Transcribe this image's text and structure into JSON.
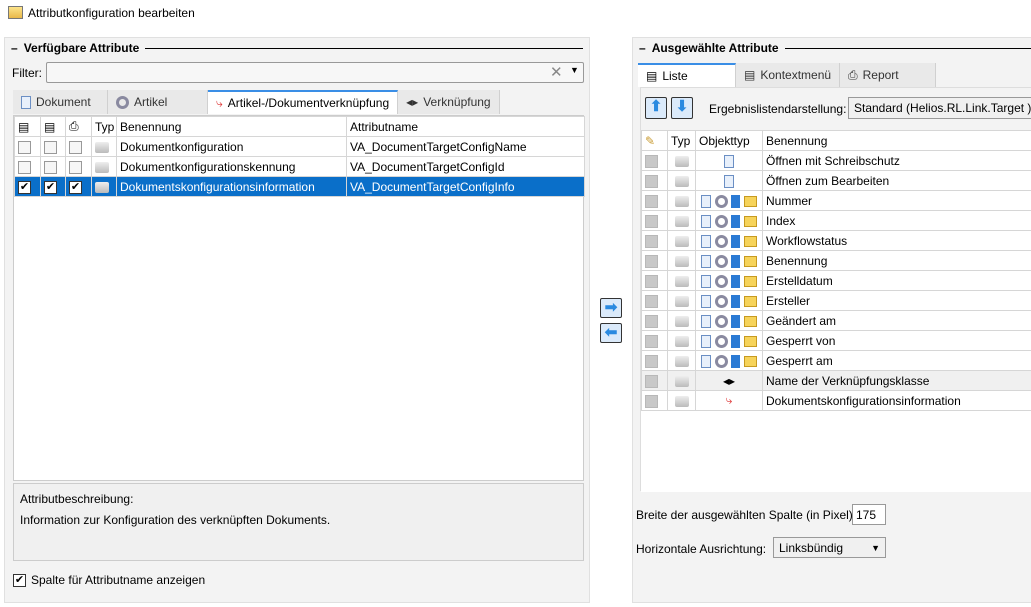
{
  "window": {
    "title": "Attributkonfiguration bearbeiten"
  },
  "left": {
    "group_title": "Verfügbare Attribute",
    "filter_label": "Filter:",
    "filter_value": "",
    "tabs": [
      {
        "label": "Dokument"
      },
      {
        "label": "Artikel"
      },
      {
        "label": "Artikel-/Dokumentverknüpfung",
        "active": true
      },
      {
        "label": "Verknüpfung"
      }
    ],
    "columns": {
      "typ": "Typ",
      "benennung": "Benennung",
      "attributname": "Attributname"
    },
    "rows": [
      {
        "benennung": "Dokumentkonfiguration",
        "attributname": "VA_DocumentTargetConfigName",
        "checks": [
          false,
          false,
          false
        ]
      },
      {
        "benennung": "Dokumentkonfigurationskennung",
        "attributname": "VA_DocumentTargetConfigId",
        "checks": [
          false,
          false,
          false
        ]
      },
      {
        "benennung": "Dokumentskonfigurationsinformation",
        "attributname": "VA_DocumentTargetConfigInfo",
        "checks": [
          true,
          true,
          true
        ],
        "selected": true
      }
    ],
    "description_label": "Attributbeschreibung:",
    "description_text": "Information zur Konfiguration des verknüpften Dokuments.",
    "show_attrname_label": "Spalte für Attributname anzeigen",
    "show_attrname_checked": true
  },
  "right": {
    "group_title": "Ausgewählte Attribute",
    "tabs": [
      {
        "label": "Liste",
        "active": true
      },
      {
        "label": "Kontextmenü"
      },
      {
        "label": "Report"
      }
    ],
    "ergebnis_label": "Ergebnislistendarstellung:",
    "ergebnis_value": "Standard (Helios.RL.Link.Target )",
    "columns": {
      "typ": "Typ",
      "objekttyp": "Objekttyp",
      "benennung": "Benennung"
    },
    "rows": [
      {
        "benennung": "Öffnen mit Schreibschutz",
        "icons": "doc"
      },
      {
        "benennung": "Öffnen zum Bearbeiten",
        "icons": "doc"
      },
      {
        "benennung": "Nummer",
        "icons": "all"
      },
      {
        "benennung": "Index",
        "icons": "all"
      },
      {
        "benennung": "Workflowstatus",
        "icons": "all"
      },
      {
        "benennung": "Benennung",
        "icons": "all"
      },
      {
        "benennung": "Erstelldatum",
        "icons": "all"
      },
      {
        "benennung": "Ersteller",
        "icons": "all"
      },
      {
        "benennung": "Geändert am",
        "icons": "all"
      },
      {
        "benennung": "Gesperrt von",
        "icons": "all"
      },
      {
        "benennung": "Gesperrt am",
        "icons": "all"
      },
      {
        "benennung": "Name der Verknüpfungsklasse",
        "icons": "linkclass",
        "grey": true
      },
      {
        "benennung": "Dokumentskonfigurationsinformation",
        "icons": "link"
      }
    ],
    "width_label": "Breite der ausgewählten Spalte (in Pixel):",
    "width_value": "175",
    "align_label": "Horizontale Ausrichtung:",
    "align_value": "Linksbündig"
  }
}
